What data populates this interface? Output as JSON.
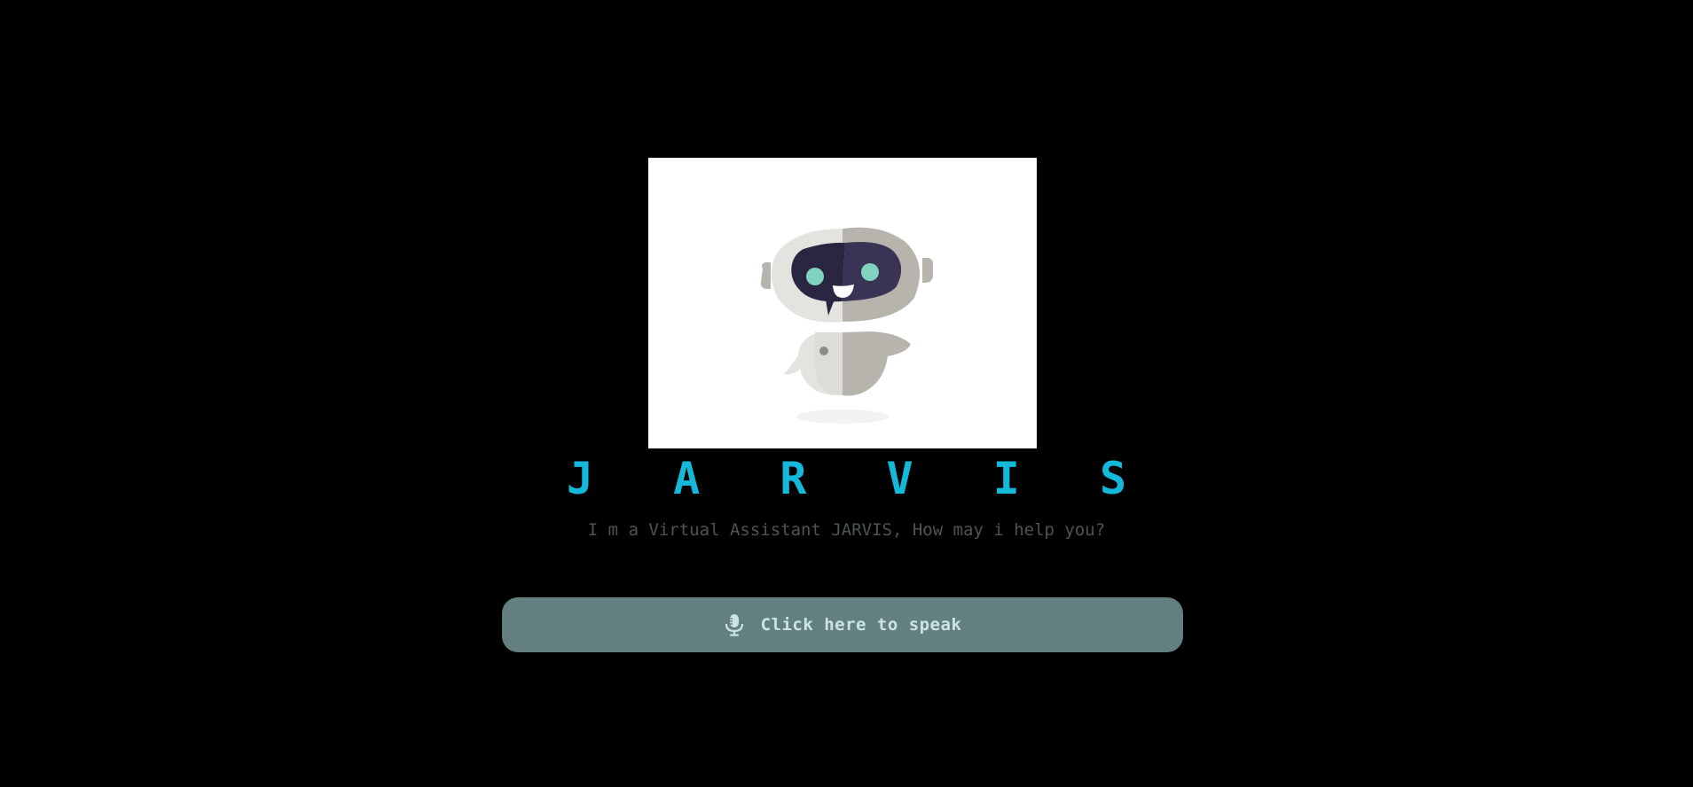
{
  "header": {
    "title": "J A R V I S",
    "subtitle": "I m a Virtual Assistant JARVIS, How may i help you?"
  },
  "hero": {
    "icon": "robot-icon",
    "background": "#ffffff"
  },
  "speak_button": {
    "label": "Click here to speak",
    "icon": "microphone-icon",
    "background": "#647f80",
    "text_color": "#c9e4e3"
  },
  "theme": {
    "page_background": "#000000",
    "accent": "#14b8d8",
    "muted_text": "#4b5456"
  }
}
